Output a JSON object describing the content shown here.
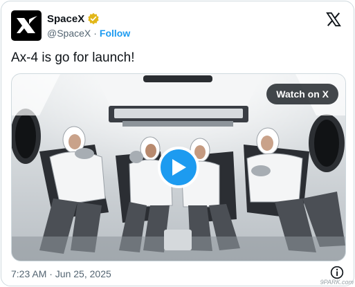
{
  "account": {
    "name": "SpaceX",
    "handle": "@SpaceX",
    "separator": "·",
    "follow_label": "Follow",
    "avatar_icon": "spacex-x-logo-icon",
    "verified_icon": "verified-gold-badge-icon"
  },
  "tweet": {
    "text": "Ax-4 is go for launch!",
    "timestamp": "7:23 AM · Jun 25, 2025"
  },
  "media": {
    "watch_label": "Watch on X",
    "play_icon": "play-icon"
  },
  "header": {
    "x_logo_icon": "x-logo-icon",
    "info_icon": "info-icon"
  },
  "watermark": "9PARK.com",
  "colors": {
    "accent": "#1d9bf0",
    "badge": "#e2b719",
    "text": "#0f1419",
    "muted": "#536471"
  }
}
